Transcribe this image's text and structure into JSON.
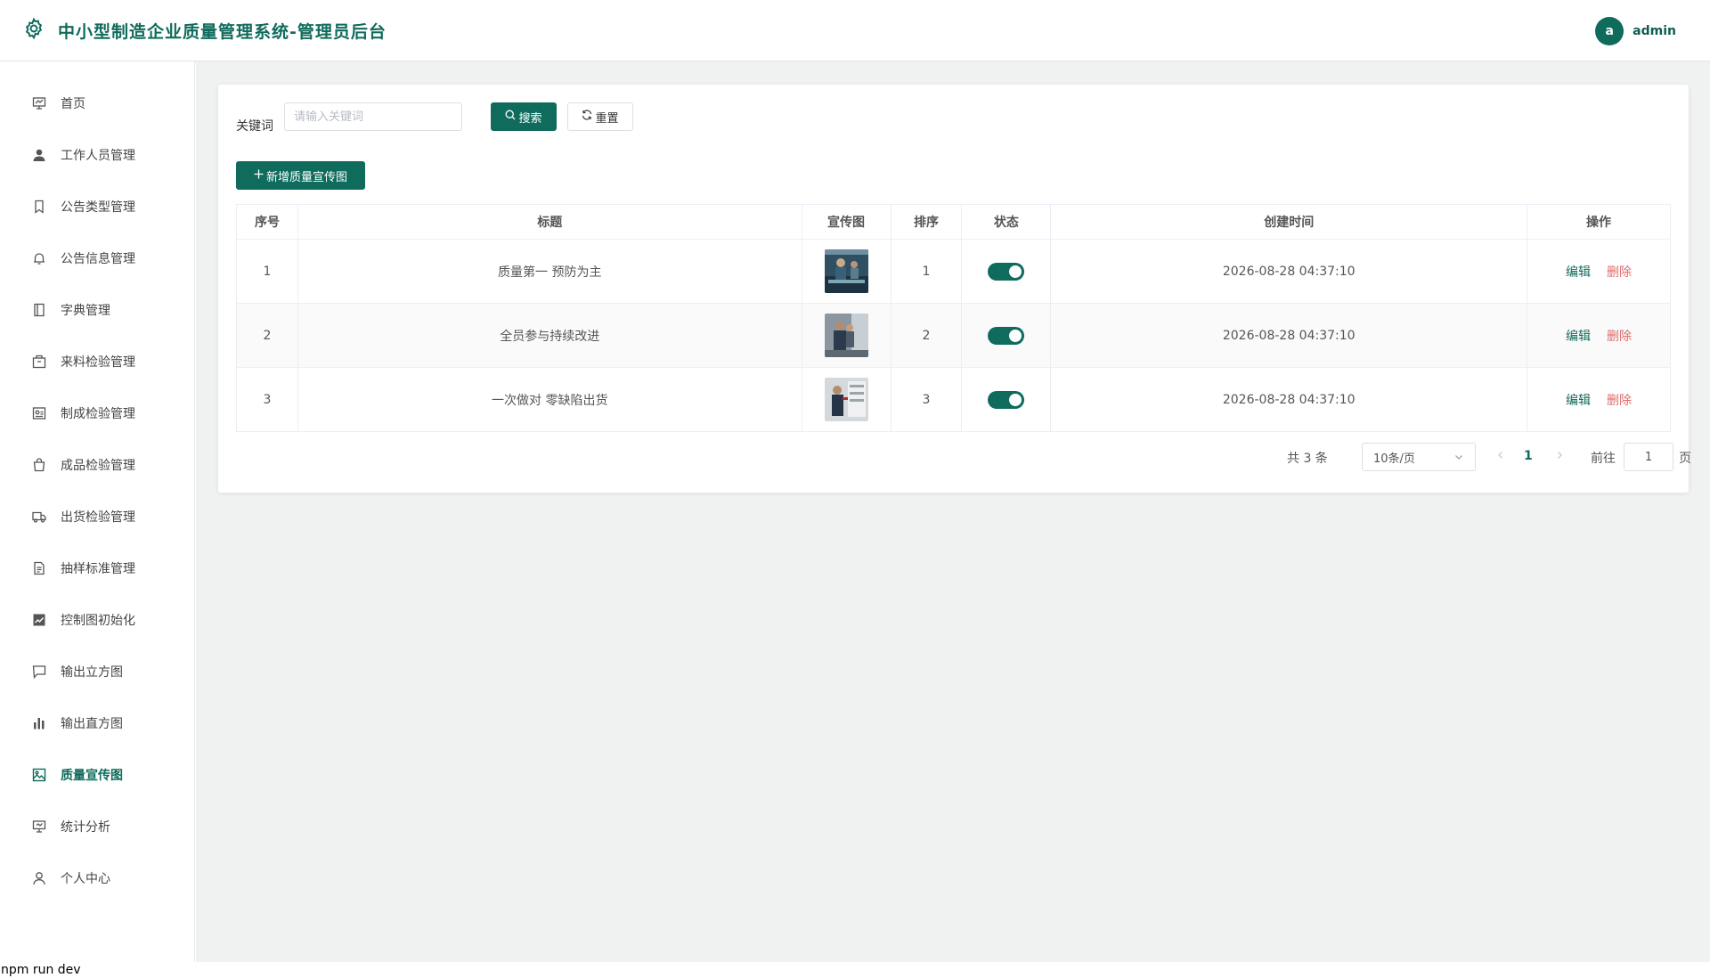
{
  "header": {
    "title": "中小型制造企业质量管理系统-管理员后台",
    "avatar_letter": "a",
    "username": "admin"
  },
  "sidebar": {
    "items": [
      {
        "label": "首页",
        "icon": "home-chart-icon"
      },
      {
        "label": "工作人员管理",
        "icon": "user-filled-icon"
      },
      {
        "label": "公告类型管理",
        "icon": "bookmark-icon"
      },
      {
        "label": "公告信息管理",
        "icon": "bell-icon"
      },
      {
        "label": "字典管理",
        "icon": "notebook-icon"
      },
      {
        "label": "来料检验管理",
        "icon": "box-icon"
      },
      {
        "label": "制成检验管理",
        "icon": "wallet-icon"
      },
      {
        "label": "成品检验管理",
        "icon": "shopping-bag-icon"
      },
      {
        "label": "出货检验管理",
        "icon": "truck-icon"
      },
      {
        "label": "抽样标准管理",
        "icon": "document-icon"
      },
      {
        "label": "控制图初始化",
        "icon": "line-chart-icon"
      },
      {
        "label": "输出立方图",
        "icon": "presentation-icon"
      },
      {
        "label": "输出直方图",
        "icon": "bar-chart-icon"
      },
      {
        "label": "质量宣传图",
        "icon": "picture-icon",
        "active": true
      },
      {
        "label": "统计分析",
        "icon": "presentation-board-icon"
      },
      {
        "label": "个人中心",
        "icon": "user-outline-icon"
      }
    ]
  },
  "filter": {
    "keyword_label": "关键词",
    "keyword_placeholder": "请输入关键词",
    "keyword_value": "",
    "search_label": "搜索",
    "reset_label": "重置"
  },
  "toolbar": {
    "add_label": "新增质量宣传图"
  },
  "table": {
    "columns": [
      "序号",
      "标题",
      "宣传图",
      "排序",
      "状态",
      "创建时间",
      "操作"
    ],
    "rows": [
      {
        "index": "1",
        "title": "质量第一 预防为主",
        "sort": "1",
        "enabled": true,
        "created": "2026-08-28 04:37:10",
        "edit": "编辑",
        "delete": "删除"
      },
      {
        "index": "2",
        "title": "全员参与持续改进",
        "sort": "2",
        "enabled": true,
        "created": "2026-08-28 04:37:10",
        "edit": "编辑",
        "delete": "删除"
      },
      {
        "index": "3",
        "title": "一次做对 零缺陷出货",
        "sort": "3",
        "enabled": true,
        "created": "2026-08-28 04:37:10",
        "edit": "编辑",
        "delete": "删除"
      }
    ]
  },
  "pagination": {
    "total": "共 3 条",
    "page_size": "10条/页",
    "current_page": "1",
    "goto_label": "前往",
    "goto_value": "1",
    "page_suffix": "页"
  },
  "terminal": {
    "text": "npm run dev"
  },
  "colors": {
    "primary": "#0f6b5c",
    "danger": "#e06b6b",
    "background": "#f0f2f1"
  }
}
